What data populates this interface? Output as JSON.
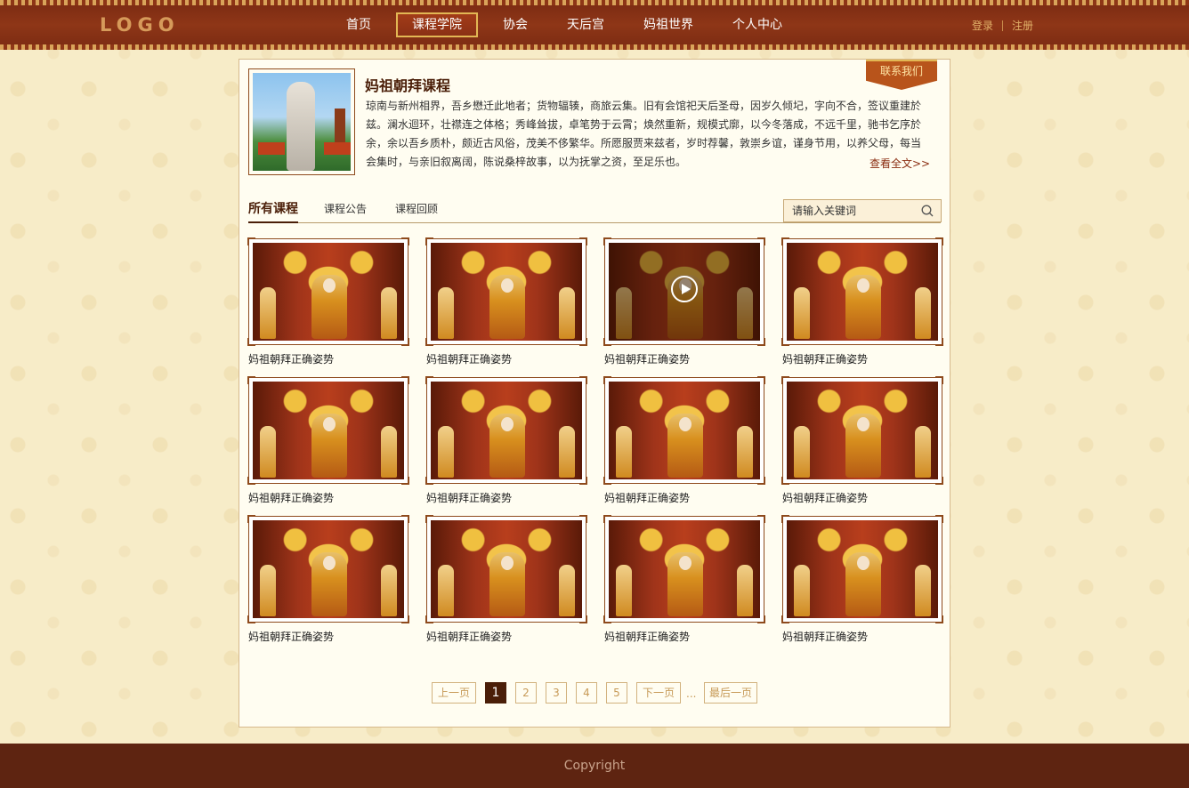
{
  "header": {
    "logo": "LOGO",
    "nav": [
      {
        "label": "首页",
        "active": false
      },
      {
        "label": "课程学院",
        "active": true
      },
      {
        "label": "协会",
        "active": false
      },
      {
        "label": "天后宫",
        "active": false
      },
      {
        "label": "妈祖世界",
        "active": false
      },
      {
        "label": "个人中心",
        "active": false
      }
    ],
    "login": "登录",
    "register": "注册"
  },
  "intro": {
    "contact_label": "联系我们",
    "title": "妈祖朝拜课程",
    "description": "琼南与新州相界，吾乡懋迁此地者；货物辐辏，商旅云集。旧有会馆祀天后圣母，因岁久倾圮，字向不合，签议重建於兹。澜水迴环，壮襟连之体格；秀峰耸拔，卓笔势于云霄；焕然重新，规模式廓，以今冬落成，不远千里，驰书乞序於余，余以吾乡质朴，颇近古风俗，茂美不侈繁华。所愿服贾来兹者，岁时荐馨，敦崇乡谊，谨身节用，以养父母，每当会集时，与亲旧叙离阔，陈说桑梓故事，以为抚掌之资，至足乐也。",
    "read_more": "查看全文>>"
  },
  "tabs": [
    {
      "label": "所有课程",
      "active": true
    },
    {
      "label": "课程公告",
      "active": false
    },
    {
      "label": "课程回顾",
      "active": false
    }
  ],
  "search": {
    "placeholder": "请输入关键词"
  },
  "courses": [
    {
      "title": "妈祖朝拜正确姿势",
      "playing": false
    },
    {
      "title": "妈祖朝拜正确姿势",
      "playing": false
    },
    {
      "title": "妈祖朝拜正确姿势",
      "playing": true
    },
    {
      "title": "妈祖朝拜正确姿势",
      "playing": false
    },
    {
      "title": "妈祖朝拜正确姿势",
      "playing": false
    },
    {
      "title": "妈祖朝拜正确姿势",
      "playing": false
    },
    {
      "title": "妈祖朝拜正确姿势",
      "playing": false
    },
    {
      "title": "妈祖朝拜正确姿势",
      "playing": false
    },
    {
      "title": "妈祖朝拜正确姿势",
      "playing": false
    },
    {
      "title": "妈祖朝拜正确姿势",
      "playing": false
    },
    {
      "title": "妈祖朝拜正确姿势",
      "playing": false
    },
    {
      "title": "妈祖朝拜正确姿势",
      "playing": false
    }
  ],
  "pagination": {
    "prev": "上一页",
    "pages": [
      "1",
      "2",
      "3",
      "4",
      "5"
    ],
    "current": "1",
    "next": "下一页",
    "ellipsis": "...",
    "last": "最后一页"
  },
  "footer": {
    "copyright": "Copyright"
  },
  "colors": {
    "brand": "#8e3617",
    "accent": "#e2b754",
    "dark": "#4a1e08",
    "footer": "#5e2411"
  }
}
